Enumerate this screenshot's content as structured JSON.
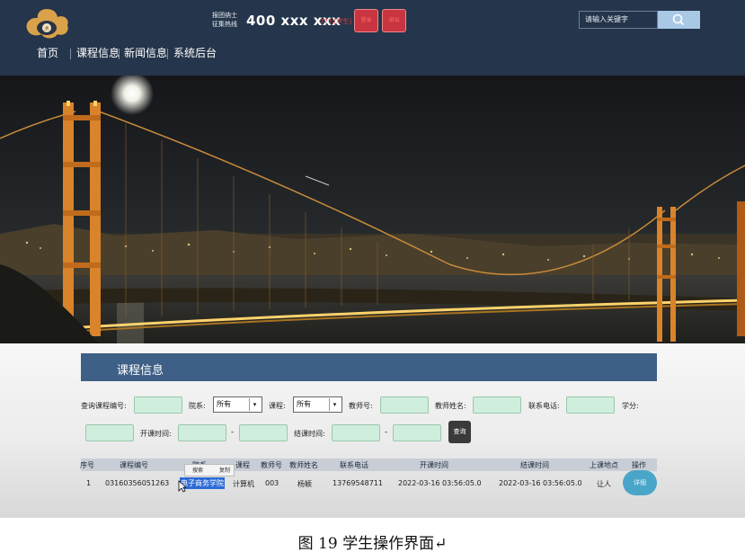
{
  "header": {
    "hotline_line1": "报团纳士",
    "hotline_line2": "征集热线",
    "hotline_number": "400 xxx xxx",
    "hotline_tag": "777,[学生]",
    "btn_login": "登录",
    "btn_exit": "退出",
    "search_placeholder": "请输入关键字"
  },
  "nav": {
    "items": [
      "首页",
      "课程信息",
      "新闻信息",
      "系统后台"
    ]
  },
  "panel": {
    "title": "课程信息"
  },
  "filters": {
    "query_label": "查询",
    "course_no_label": "课程编号:",
    "dept_label": "院系:",
    "dept_value": "所有",
    "course_label": "课程:",
    "course_value": "所有",
    "teacher_no_label": "教师号:",
    "teacher_name_label": "教师姓名:",
    "phone_label": "联系电话:",
    "credit_label": "学分:",
    "start_label": "开课时间:",
    "end_label": "结课时间:",
    "range_dash": "-",
    "query_button": "查询"
  },
  "table": {
    "headers": [
      "序号",
      "课程编号",
      "院系",
      "课程",
      "教师号",
      "教师姓名",
      "联系电话",
      "开课时间",
      "结课时间",
      "上课地点",
      "操作"
    ],
    "rows": [
      [
        "1",
        "03160356051263",
        "电子商务学院",
        "计算机",
        "003",
        "杨颖",
        "13769548711",
        "2022-03-16 03:56:05.0",
        "2022-03-16 03:56:05.0",
        "让人",
        "详细"
      ]
    ],
    "context_menu": [
      "搜索",
      "复制"
    ]
  },
  "caption": "图 19  学生操作界面↵",
  "colors": {
    "header_bg": "#25354b",
    "panel_head": "#3e5f86",
    "input_fill": "#cfeedd",
    "detail_btn": "#4aa6c9"
  }
}
